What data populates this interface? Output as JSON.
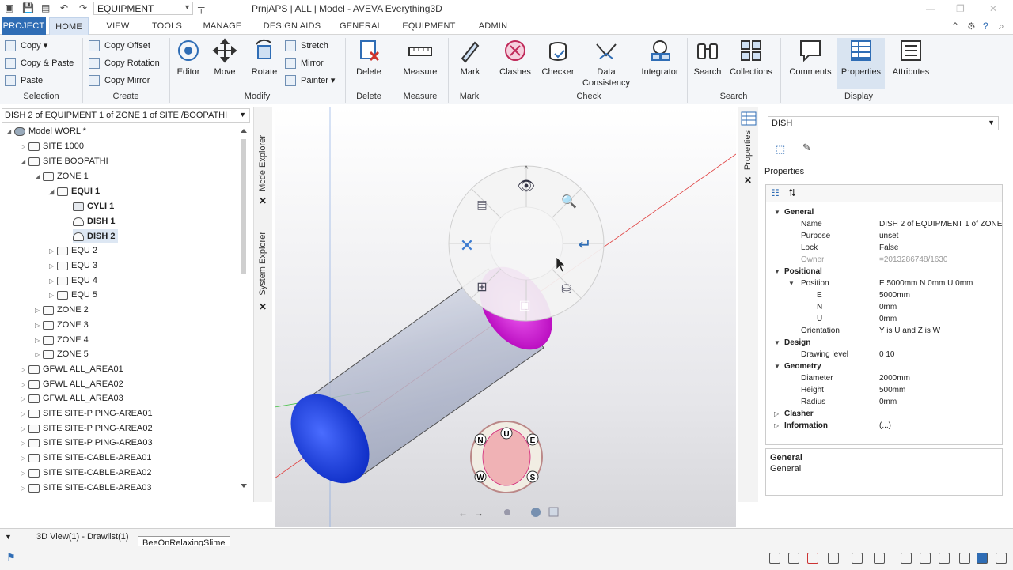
{
  "app": {
    "title": "PrnjAPS | ALL | Model - AVEVA Everything3D",
    "context_combo": "EQUIPMENT"
  },
  "tabs": [
    "PROJECT",
    "HOME",
    "VIEW",
    "TOOLS",
    "MANAGE",
    "DESIGN AIDS",
    "GENERAL",
    "EQUIPMENT",
    "ADMIN"
  ],
  "ribbon": {
    "selection": {
      "label": "Selection",
      "copy": "Copy",
      "copy_paste": "Copy & Paste",
      "paste": "Paste"
    },
    "create": {
      "label": "Create",
      "copy_offset": "Copy Offset",
      "copy_rotation": "Copy Rotation",
      "copy_mirror": "Copy Mirror"
    },
    "modify": {
      "label": "Modify",
      "editor": "Editor",
      "move": "Move",
      "rotate": "Rotate",
      "stretch": "Stretch",
      "mirror": "Mirror",
      "painter": "Painter"
    },
    "delete": {
      "label": "Delete",
      "btn": "Delete"
    },
    "measure": {
      "label": "Measure",
      "btn": "Measure"
    },
    "mark": {
      "label": "Mark",
      "btn": "Mark"
    },
    "check": {
      "label": "Check",
      "clashes": "Clashes",
      "checker": "Checker",
      "data_consistency_1": "Data",
      "data_consistency_2": "Consistency",
      "integrator": "Integrator"
    },
    "search": {
      "label": "Search",
      "search": "Search",
      "collections": "Collections"
    },
    "display": {
      "label": "Display",
      "comments": "Comments",
      "properties": "Properties",
      "attributes": "Attributes"
    }
  },
  "tree": {
    "crumb": "DISH 2 of EQUIPMENT 1 of ZONE 1 of SITE /BOOPATHI",
    "items": [
      {
        "label": "Model WORL *"
      },
      {
        "label": "SITE 1000"
      },
      {
        "label": "SITE BOOPATHI"
      },
      {
        "label": "ZONE 1"
      },
      {
        "label": "EQUI 1"
      },
      {
        "label": "CYLI 1"
      },
      {
        "label": "DISH 1"
      },
      {
        "label": "DISH 2"
      },
      {
        "label": "EQU 2"
      },
      {
        "label": "EQU 3"
      },
      {
        "label": "EQU 4"
      },
      {
        "label": "EQU 5"
      },
      {
        "label": "ZONE 2"
      },
      {
        "label": "ZONE 3"
      },
      {
        "label": "ZONE 4"
      },
      {
        "label": "ZONE 5"
      },
      {
        "label": "GFWL ALL_AREA01"
      },
      {
        "label": "GFWL ALL_AREA02"
      },
      {
        "label": "GFWL ALL_AREA03"
      },
      {
        "label": "SITE SITE-P PING-AREA01"
      },
      {
        "label": "SITE SITE-P PING-AREA02"
      },
      {
        "label": "SITE SITE-P PING-AREA03"
      },
      {
        "label": "SITE SITE-CABLE-AREA01"
      },
      {
        "label": "SITE SITE-CABLE-AREA02"
      },
      {
        "label": "SITE SITE-CABLE-AREA03"
      }
    ]
  },
  "side_tabs": {
    "model_explorer": "Mcde Explorer",
    "system_explorer": "System Explorer",
    "properties": "Properties"
  },
  "compass": {
    "up": "U",
    "north": "N",
    "east": "E",
    "west": "W",
    "south": "S"
  },
  "properties": {
    "combo": "DISH",
    "tab": "Properties",
    "rows": [
      {
        "cat": true,
        "key": "General"
      },
      {
        "key": "Name",
        "value": "DISH 2 of EQUIPMENT 1 of ZONE"
      },
      {
        "key": "Purpose",
        "value": "unset"
      },
      {
        "key": "Lock",
        "value": "False"
      },
      {
        "key": "Owner",
        "value": "=2013286748/1630"
      },
      {
        "cat": true,
        "key": "Positional"
      },
      {
        "key": "Position",
        "value": "E 5000mm N 0mm U 0mm"
      },
      {
        "key": "E",
        "value": "5000mm"
      },
      {
        "key": "N",
        "value": "0mm"
      },
      {
        "key": "U",
        "value": "0mm"
      },
      {
        "key": "Orientation",
        "value": "Y is U and Z is W"
      },
      {
        "cat": true,
        "key": "Design"
      },
      {
        "key": "Drawing level",
        "value": "0 10"
      },
      {
        "cat": true,
        "key": "Geometry"
      },
      {
        "key": "Diameter",
        "value": "2000mm"
      },
      {
        "key": "Height",
        "value": "500mm"
      },
      {
        "key": "Radius",
        "value": "0mm"
      },
      {
        "cat": true,
        "key": "Clasher"
      },
      {
        "cat": true,
        "key": "Information",
        "value": "(...)"
      }
    ],
    "desc_title": "General",
    "desc_text": "General"
  },
  "status": {
    "view_tab": "3D View(1) - Drawlist(1)",
    "tooltip": "BeeOnRelaxingSlime"
  }
}
